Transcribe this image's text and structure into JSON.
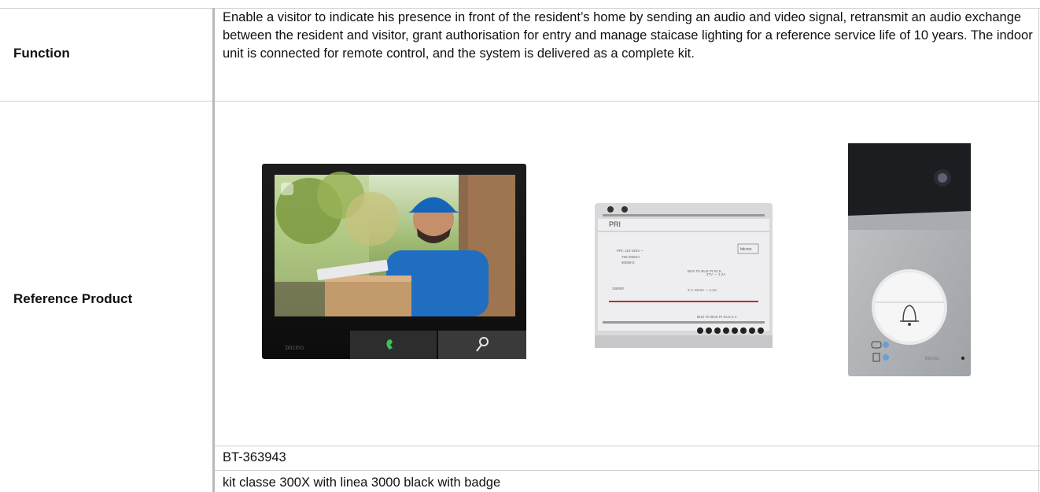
{
  "spec_table": {
    "function": {
      "label": "Function",
      "description": "Enable a visitor to indicate his presence in front of the resident’s home by sending an audio and video signal, retransmit an audio exchange between the resident and visitor, grant authorisation for entry and manage staicase lighting for a reference service life of 10 years. The indoor unit is connected for remote control, and the system is delivered as a complete kit."
    },
    "reference_product": {
      "label": "Reference Product",
      "sku": "BT-363943",
      "name": "kit classe 300X with linea 3000 black with badge",
      "images": {
        "indoor_monitor": {
          "brand": "bticino"
        },
        "power_supply": {
          "top_label": "PRI",
          "rating": "PRI: 110-240V ~",
          "current": "750-400mA",
          "freq": "50/60Hz",
          "bus_lines": "BUS TK\nBUS PI\nSCS",
          "out_bus": "27V --- 1.2A",
          "aux": "2-1: 26.5V --- 1.2A",
          "model": "346050",
          "brand": "bticino",
          "terminals": "BUS TK  BUS PI  SCS  2-1"
        },
        "door_panel": {
          "brand": "bticino"
        }
      }
    }
  }
}
